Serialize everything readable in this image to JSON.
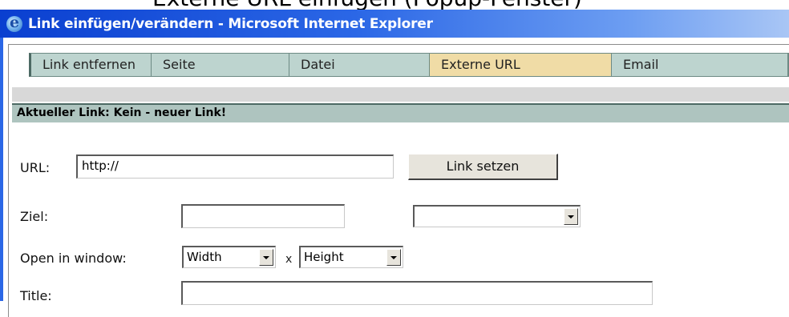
{
  "clipped_header": "Externe URL einfügen (Popup-Fenster)",
  "window": {
    "title": "Link einfügen/verändern - Microsoft Internet Explorer"
  },
  "tabs": [
    {
      "label": "Link entfernen"
    },
    {
      "label": "Seite"
    },
    {
      "label": "Datei"
    },
    {
      "label": "Externe URL",
      "active": true
    },
    {
      "label": "Email"
    }
  ],
  "current_link": "Aktueller Link: Kein - neuer Link!",
  "form": {
    "url_label": "URL:",
    "url_value": "http://",
    "set_link_button": "Link setzen",
    "target_label": "Ziel:",
    "target_value": "",
    "target_select_value": "",
    "open_window_label": "Open in window:",
    "width_select": "Width",
    "times_sign": "x",
    "height_select": "Height",
    "title_label": "Title:",
    "title_value": ""
  },
  "colors": {
    "titlebar_start": "#0a3fd0",
    "tab_bg": "#bdd4cf",
    "tab_active_bg": "#f0dca6",
    "current_link_bg": "#aec4bf"
  }
}
